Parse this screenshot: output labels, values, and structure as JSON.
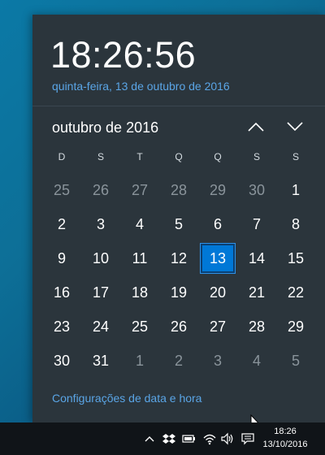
{
  "flyout": {
    "time": "18:26:56",
    "full_date": "quinta-feira, 13 de outubro de 2016",
    "month_label": "outubro de 2016",
    "weekdays": [
      "D",
      "S",
      "T",
      "Q",
      "Q",
      "S",
      "S"
    ],
    "days": [
      {
        "label": "25",
        "muted": true
      },
      {
        "label": "26",
        "muted": true
      },
      {
        "label": "27",
        "muted": true
      },
      {
        "label": "28",
        "muted": true
      },
      {
        "label": "29",
        "muted": true
      },
      {
        "label": "30",
        "muted": true
      },
      {
        "label": "1",
        "muted": false
      },
      {
        "label": "2",
        "muted": false
      },
      {
        "label": "3",
        "muted": false
      },
      {
        "label": "4",
        "muted": false
      },
      {
        "label": "5",
        "muted": false
      },
      {
        "label": "6",
        "muted": false
      },
      {
        "label": "7",
        "muted": false
      },
      {
        "label": "8",
        "muted": false
      },
      {
        "label": "9",
        "muted": false
      },
      {
        "label": "10",
        "muted": false
      },
      {
        "label": "11",
        "muted": false
      },
      {
        "label": "12",
        "muted": false
      },
      {
        "label": "13",
        "muted": false,
        "today": true
      },
      {
        "label": "14",
        "muted": false
      },
      {
        "label": "15",
        "muted": false
      },
      {
        "label": "16",
        "muted": false
      },
      {
        "label": "17",
        "muted": false
      },
      {
        "label": "18",
        "muted": false
      },
      {
        "label": "19",
        "muted": false
      },
      {
        "label": "20",
        "muted": false
      },
      {
        "label": "21",
        "muted": false
      },
      {
        "label": "22",
        "muted": false
      },
      {
        "label": "23",
        "muted": false
      },
      {
        "label": "24",
        "muted": false
      },
      {
        "label": "25",
        "muted": false
      },
      {
        "label": "26",
        "muted": false
      },
      {
        "label": "27",
        "muted": false
      },
      {
        "label": "28",
        "muted": false
      },
      {
        "label": "29",
        "muted": false
      },
      {
        "label": "30",
        "muted": false
      },
      {
        "label": "31",
        "muted": false
      },
      {
        "label": "1",
        "muted": true
      },
      {
        "label": "2",
        "muted": true
      },
      {
        "label": "3",
        "muted": true
      },
      {
        "label": "4",
        "muted": true
      },
      {
        "label": "5",
        "muted": true
      }
    ],
    "settings_link": "Configurações de data e hora"
  },
  "taskbar": {
    "time": "18:26",
    "date": "13/10/2016",
    "icons": [
      "chevron-up-icon",
      "dropbox-icon",
      "battery-icon",
      "wifi-icon",
      "volume-icon",
      "action-center-icon"
    ]
  },
  "colors": {
    "flyout_bg": "#2b353c",
    "accent": "#0078d7",
    "link": "#5aa5e6",
    "muted_day": "#8a949b",
    "taskbar_bg": "#101418"
  }
}
